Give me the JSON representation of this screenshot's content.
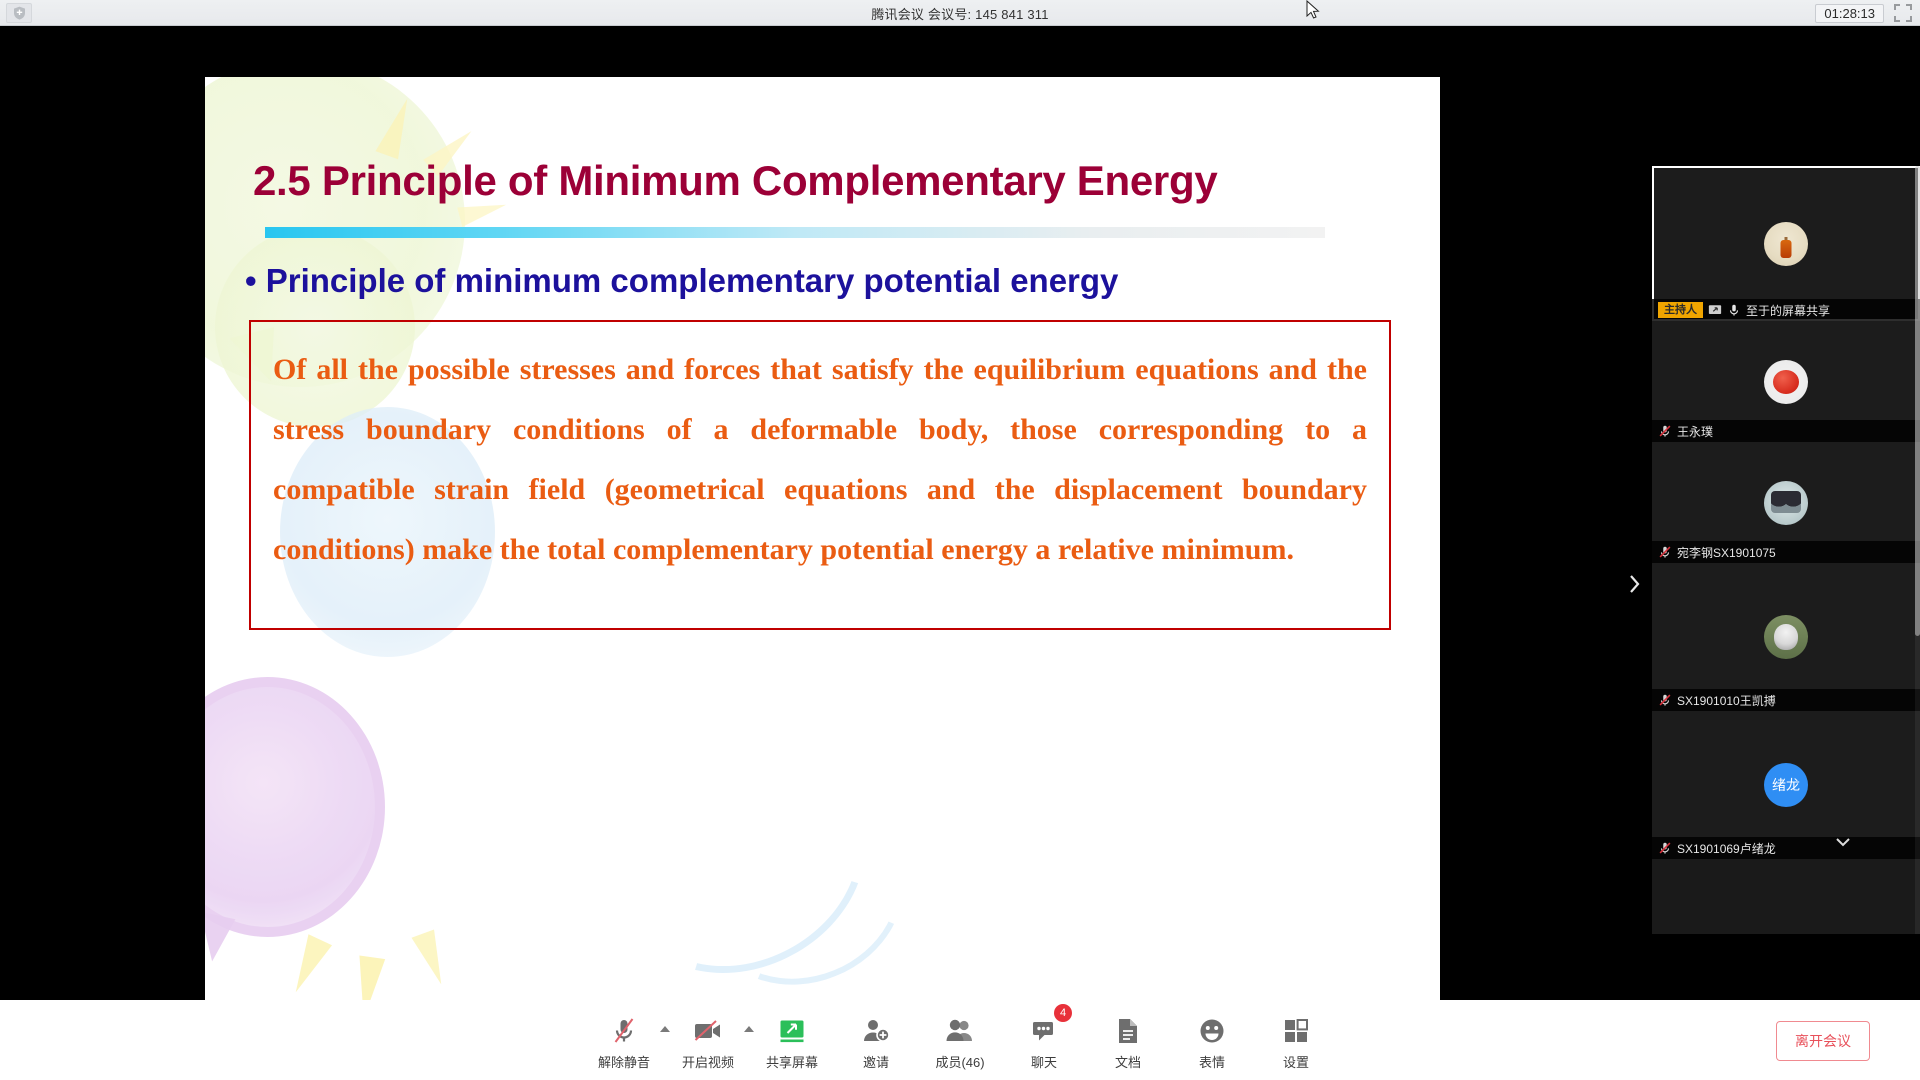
{
  "titlebar": {
    "app_title": "腾讯会议 会议号: 145 841 311",
    "timer": "01:28:13",
    "shield_icon": "shield-icon",
    "restore_icon": "restore-window-icon"
  },
  "slide": {
    "title": "2.5 Principle of Minimum Complementary Energy",
    "subtitle": "• Principle of minimum complementary potential energy",
    "body": "Of all the possible stresses and forces that satisfy the equilibrium equations and the stress boundary conditions of a deformable body, those corresponding to a compatible strain field (geometrical equations and the displacement boundary conditions) make the total complementary potential energy a relative minimum.",
    "colors": {
      "title": "#9c0037",
      "subtitle": "#1c119c",
      "body": "#ea5c12",
      "box_border": "#c00000",
      "rule_start": "#28c6f0"
    }
  },
  "panel": {
    "collapse_icon": "chevron-right-icon",
    "more_icon": "chevron-down-icon",
    "participants": [
      {
        "name": "至于的屏幕共享",
        "host_badge": "主持人",
        "share_icon": "screen-share-icon",
        "mic_icon": "mic-on-icon",
        "avatar": "lantern-avatar",
        "selected": true
      },
      {
        "name": "王永璞",
        "host_badge": "",
        "share_icon": "",
        "mic_icon": "mic-muted-icon",
        "avatar": "tomato-avatar",
        "selected": false
      },
      {
        "name": "宛李钢SX1901075",
        "host_badge": "",
        "share_icon": "",
        "mic_icon": "mic-muted-icon",
        "avatar": "twins-avatar",
        "selected": false
      },
      {
        "name": "SX1901010王凯搏",
        "host_badge": "",
        "share_icon": "",
        "mic_icon": "mic-muted-icon",
        "avatar": "dog-avatar",
        "selected": false
      },
      {
        "name": "SX1901069卢绪龙",
        "host_badge": "",
        "share_icon": "",
        "mic_icon": "mic-muted-icon",
        "avatar": "绪龙",
        "selected": false
      }
    ]
  },
  "toolbar": {
    "items": [
      {
        "label": "解除静音",
        "icon": "mic-muted-icon",
        "caret": true,
        "badge": ""
      },
      {
        "label": "开启视频",
        "icon": "camera-off-icon",
        "caret": true,
        "badge": ""
      },
      {
        "label": "共享屏幕",
        "icon": "screen-share-icon",
        "caret": false,
        "badge": ""
      },
      {
        "label": "邀请",
        "icon": "invite-user-icon",
        "caret": false,
        "badge": ""
      },
      {
        "label": "成员(46)",
        "icon": "members-icon",
        "caret": false,
        "badge": ""
      },
      {
        "label": "聊天",
        "icon": "chat-icon",
        "caret": false,
        "badge": "4"
      },
      {
        "label": "文档",
        "icon": "document-icon",
        "caret": false,
        "badge": ""
      },
      {
        "label": "表情",
        "icon": "emoji-icon",
        "caret": false,
        "badge": ""
      },
      {
        "label": "设置",
        "icon": "settings-grid-icon",
        "caret": false,
        "badge": ""
      }
    ],
    "leave_label": "离开会议",
    "leave_color": "#e8505a"
  }
}
